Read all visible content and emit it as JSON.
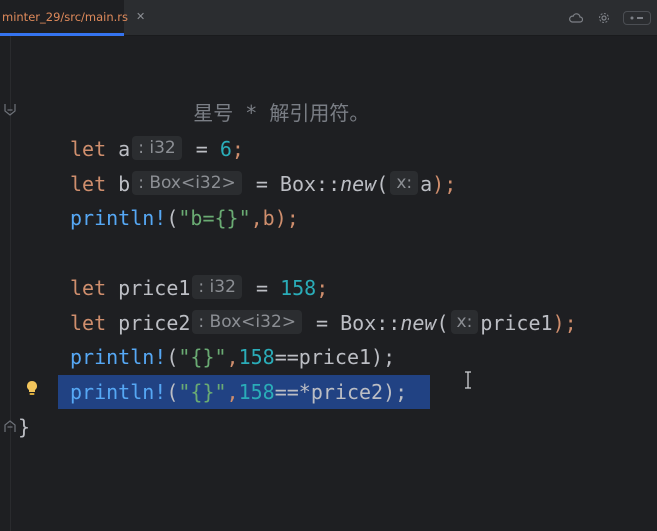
{
  "tab": {
    "path": "minter_29/src/main.rs",
    "close_glyph": "✕"
  },
  "toolbar": {
    "icon_a": "cloud-icon",
    "icon_b": "settings-icon"
  },
  "colors": {
    "keyword": "#cf8e6d",
    "number": "#2aacb8",
    "string": "#6aab73",
    "macro": "#56a8f5",
    "comment": "#7a7e85",
    "selection": "#214283",
    "background": "#1e1f22",
    "tab_accent": "#3574f0"
  },
  "code": {
    "line1": {
      "comment": "星号 * 解引用符。"
    },
    "line2": {
      "comment": "*/"
    },
    "line3": {
      "kw": "let",
      "name": "a",
      "hint": ": i32",
      "op": "=",
      "value": "6",
      "end": ";"
    },
    "line4": {
      "kw": "let",
      "name": "b",
      "hint": ": Box<i32>",
      "op": "= Box::",
      "fn": "new",
      "open": "(",
      "param_hint": "x:",
      "arg": "a",
      "close": ");"
    },
    "line5": {
      "macro": "println!",
      "open": "(",
      "str": "\"b={}\"",
      "rest": ",b);"
    },
    "line7": {
      "kw": "let",
      "name": "price1",
      "hint": ": i32",
      "op": "=",
      "value": "158",
      "end": ";"
    },
    "line8": {
      "kw": "let",
      "name": "price2",
      "hint": ": Box<i32>",
      "op": "= Box::",
      "fn": "new",
      "open": "(",
      "param_hint": "x:",
      "arg": "price1",
      "close": ");"
    },
    "line9": {
      "macro": "println!",
      "open": "(",
      "str": "\"{}\"",
      "comma": ",",
      "num": "158",
      "rest": "==price1);"
    },
    "line10": {
      "macro": "println!",
      "open": "(",
      "str": "\"{}\"",
      "comma": ",",
      "num": "158",
      "rest": "==*price2);"
    },
    "line11": {
      "brace": "}"
    }
  }
}
